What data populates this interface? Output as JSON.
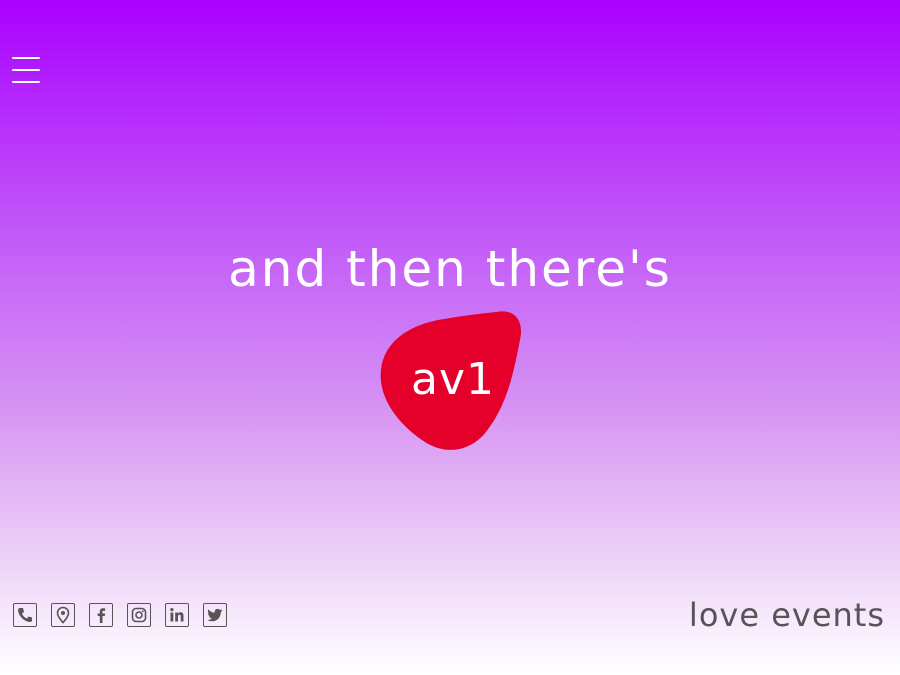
{
  "header": {
    "menu_icon": "hamburger-menu-icon"
  },
  "hero": {
    "headline": "and then there's",
    "logo_text": "av1",
    "logo_color": "#e4002b"
  },
  "footer": {
    "social_icons": [
      "phone-icon",
      "location-pin-icon",
      "facebook-icon",
      "instagram-icon",
      "linkedin-icon",
      "twitter-icon"
    ],
    "tagline": "love events"
  },
  "colors": {
    "gradient_top": "#aa00ff",
    "gradient_bottom": "#ffffff",
    "text_light": "#ffffff",
    "text_dark": "#555555"
  }
}
